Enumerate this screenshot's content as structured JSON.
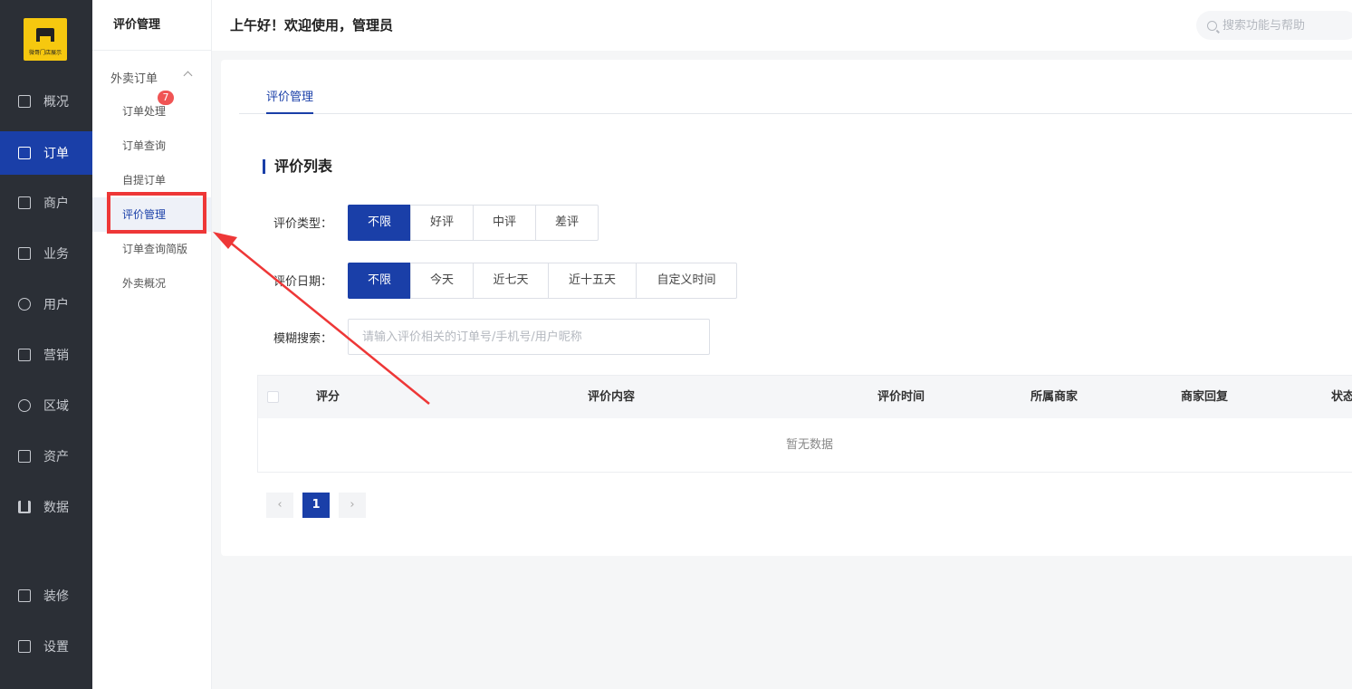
{
  "logo": {
    "text": "微哥门店展示"
  },
  "rail": {
    "items": [
      {
        "label": "概况",
        "icon": "chart-board-icon"
      },
      {
        "label": "订单",
        "icon": "order-list-icon"
      },
      {
        "label": "商户",
        "icon": "merchant-icon"
      },
      {
        "label": "业务",
        "icon": "business-icon"
      },
      {
        "label": "用户",
        "icon": "user-icon"
      },
      {
        "label": "营销",
        "icon": "marketing-icon"
      },
      {
        "label": "区域",
        "icon": "region-icon"
      },
      {
        "label": "资产",
        "icon": "assets-icon"
      },
      {
        "label": "数据",
        "icon": "bar-chart-icon"
      },
      {
        "label": "装修",
        "icon": "decorate-icon"
      },
      {
        "label": "设置",
        "icon": "settings-icon"
      }
    ],
    "active": "订单"
  },
  "subnav": {
    "title": "评价管理",
    "group": "外卖订单",
    "badge": "7",
    "items": [
      "订单处理",
      "订单查询",
      "自提订单",
      "评价管理",
      "订单查询简版",
      "外卖概况"
    ],
    "active": "评价管理"
  },
  "header": {
    "greeting": "上午好！欢迎使用，管理员",
    "search_placeholder": "搜索功能与帮助"
  },
  "main": {
    "tab": "评价管理",
    "section_title": "评价列表",
    "filters": {
      "type_label": "评价类型：",
      "type_options": [
        "不限",
        "好评",
        "中评",
        "差评"
      ],
      "type_selected": "不限",
      "date_label": "评价日期：",
      "date_options": [
        "不限",
        "今天",
        "近七天",
        "近十五天",
        "自定义时间"
      ],
      "date_selected": "不限",
      "search_label": "模糊搜索：",
      "search_placeholder": "请输入评价相关的订单号/手机号/用户昵称"
    },
    "table": {
      "columns": [
        "评分",
        "评价内容",
        "评价时间",
        "所属商家",
        "商家回复",
        "状态"
      ],
      "empty_text": "暂无数据"
    },
    "pagination": {
      "current": "1",
      "prev": "‹",
      "next": "›"
    }
  },
  "colors": {
    "primary": "#1a3fa8",
    "rail_bg": "#2b2f36",
    "logo_bg": "#f6c80f",
    "annotation": "#ee3737",
    "badge": "#f05454"
  }
}
